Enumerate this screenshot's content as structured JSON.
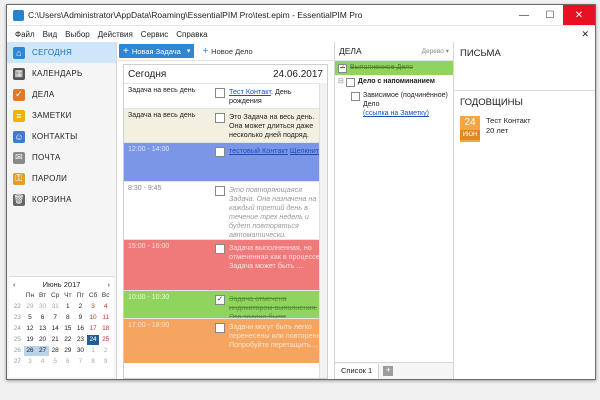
{
  "window": {
    "title": "C:\\Users\\Administrator\\AppData\\Roaming\\EssentialPIM Pro\\test.epim - EssentialPIM Pro"
  },
  "menu": [
    "Файл",
    "Вид",
    "Выбор",
    "Действия",
    "Сервис",
    "Справка"
  ],
  "sidebar": {
    "items": [
      {
        "label": "СЕГОДНЯ",
        "icon": "home-icon",
        "color": "#2e86d4",
        "active": true
      },
      {
        "label": "КАЛЕНДАРЬ",
        "icon": "calendar-icon",
        "color": "#555555"
      },
      {
        "label": "ДЕЛА",
        "icon": "checklist-icon",
        "color": "#e07a2a"
      },
      {
        "label": "ЗАМЕТКИ",
        "icon": "notes-icon",
        "color": "#f0b400"
      },
      {
        "label": "КОНТАКТЫ",
        "icon": "contacts-icon",
        "color": "#3a7bd5"
      },
      {
        "label": "ПОЧТА",
        "icon": "mail-icon",
        "color": "#8a8a8a"
      },
      {
        "label": "ПАРОЛИ",
        "icon": "key-icon",
        "color": "#e0a020"
      },
      {
        "label": "КОРЗИНА",
        "icon": "trash-icon",
        "color": "#666666"
      }
    ]
  },
  "calendar": {
    "month": "Июнь 2017",
    "weekdays": [
      "",
      "Пн",
      "Вт",
      "Ср",
      "Чт",
      "Пт",
      "Сб",
      "Вс"
    ],
    "weeks": [
      [
        "22",
        "29",
        "30",
        "31",
        "1",
        "2",
        "3",
        "4"
      ],
      [
        "23",
        "5",
        "6",
        "7",
        "8",
        "9",
        "10",
        "11"
      ],
      [
        "24",
        "12",
        "13",
        "14",
        "15",
        "16",
        "17",
        "18"
      ],
      [
        "25",
        "19",
        "20",
        "21",
        "22",
        "23",
        "24",
        "25"
      ],
      [
        "26",
        "26",
        "27",
        "28",
        "29",
        "30",
        "1",
        "2"
      ],
      [
        "27",
        "3",
        "4",
        "5",
        "6",
        "7",
        "8",
        "9"
      ]
    ],
    "today": "24"
  },
  "toolbar": {
    "new_task": "Новая Задача",
    "new_todo": "Новое Дело"
  },
  "today": {
    "title": "Сегодня",
    "date": "24.06.2017",
    "rows": [
      {
        "time": "Задача на весь день",
        "link": "Тест Контакт",
        "text": ". День рождения",
        "bg": "#ffffff"
      },
      {
        "time": "Задача на весь день",
        "text": "Это Задача на весь день. Она может длиться даже несколько дней подряд.",
        "bg": "#f3f0e1"
      },
      {
        "time": "12:00 - 14:00",
        "link": "тестовый Контакт",
        "text2": "Щелкните",
        "bg": "#7b96e6"
      },
      {
        "time": "8:30 - 9:45",
        "text": "Это повторяющаяся Задача. Она назначена на каждый третий день в течение трех недель и будет повторяться автоматически.",
        "bg": "#ffffff"
      },
      {
        "time": "15:00 - 16:00",
        "text": "Задача выполненная, но отмеченная как в процессе. Задача может быть …",
        "bg": "#f07a7a"
      },
      {
        "time": "10:00 - 10:30",
        "text": "Задача отмечена индикатором выполнения. Эта задача была выполнена.",
        "bg": "#8fd45f"
      },
      {
        "time": "17:00 - 18:00",
        "text": "Задачи могут быть легко перенесены или повторены. Попробуйте перетащить…",
        "bg": "#f5a560"
      }
    ]
  },
  "tasks": {
    "title": "ДЕЛА",
    "view": "Дерево",
    "items": [
      {
        "text": "Выполненное Дело",
        "done": true,
        "bg": "#8fd45f",
        "indent": 0
      },
      {
        "text": "Дело с напоминанием",
        "bold": true,
        "indent": 0
      },
      {
        "text": "Зависимое (подчинённое) Дело",
        "link": "(ссылка на Заметку)",
        "indent": 1
      }
    ],
    "tab": "Список 1"
  },
  "mail": {
    "title": "ПИСЬМА"
  },
  "anniversaries": {
    "title": "ГОДОВЩИНЫ",
    "day": "24",
    "month": "ИЮН",
    "name": "Тест Контакт",
    "age": "20 лет"
  }
}
